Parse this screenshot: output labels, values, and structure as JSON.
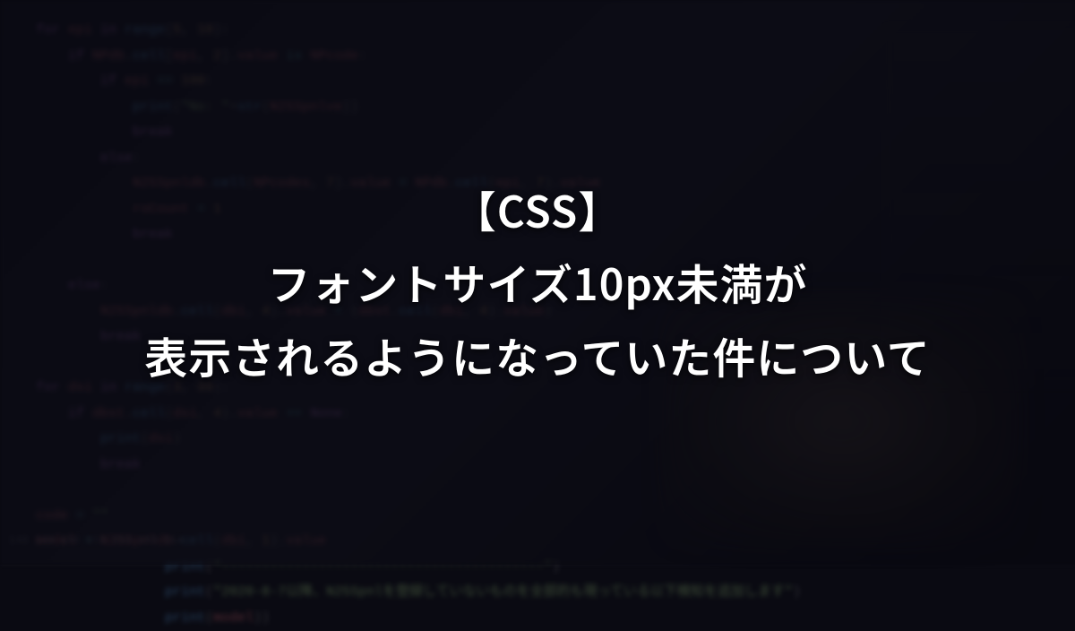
{
  "title": {
    "line1": "【CSS】",
    "line2": "フォントサイズ10px未満が",
    "line3": "表示されるようになっていた件について"
  }
}
